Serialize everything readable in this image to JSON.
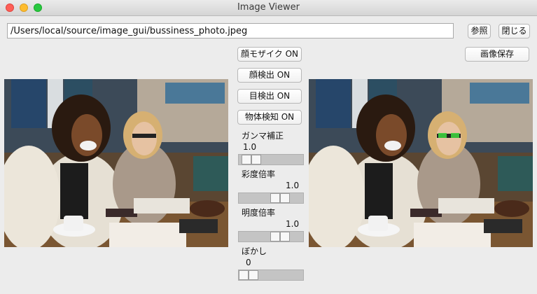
{
  "window": {
    "title": "Image Viewer"
  },
  "file": {
    "path": "/Users/local/source/image_gui/bussiness_photo.jpeg"
  },
  "toolbar": {
    "browse_label": "参照",
    "close_label": "閉じる",
    "save_label": "画像保存"
  },
  "toggles": {
    "face_mosaic": "顔モザイク ON",
    "face_detect": "顔検出 ON",
    "eye_detect": "目検出 ON",
    "object_detect": "物体検知 ON"
  },
  "sliders": {
    "gamma": {
      "label": "ガンマ補正",
      "value": "1.0",
      "level": 0.06
    },
    "saturation": {
      "label": "彩度倍率",
      "value": "1.0",
      "level": 0.7
    },
    "brightness": {
      "label": "明度倍率",
      "value": "1.0",
      "level": 0.7
    },
    "blur": {
      "label": "ぼかし",
      "value": "0",
      "level": 0.0
    }
  },
  "colors": {
    "window_bg": "#ececec",
    "slider_track": "#c4c4c4"
  }
}
